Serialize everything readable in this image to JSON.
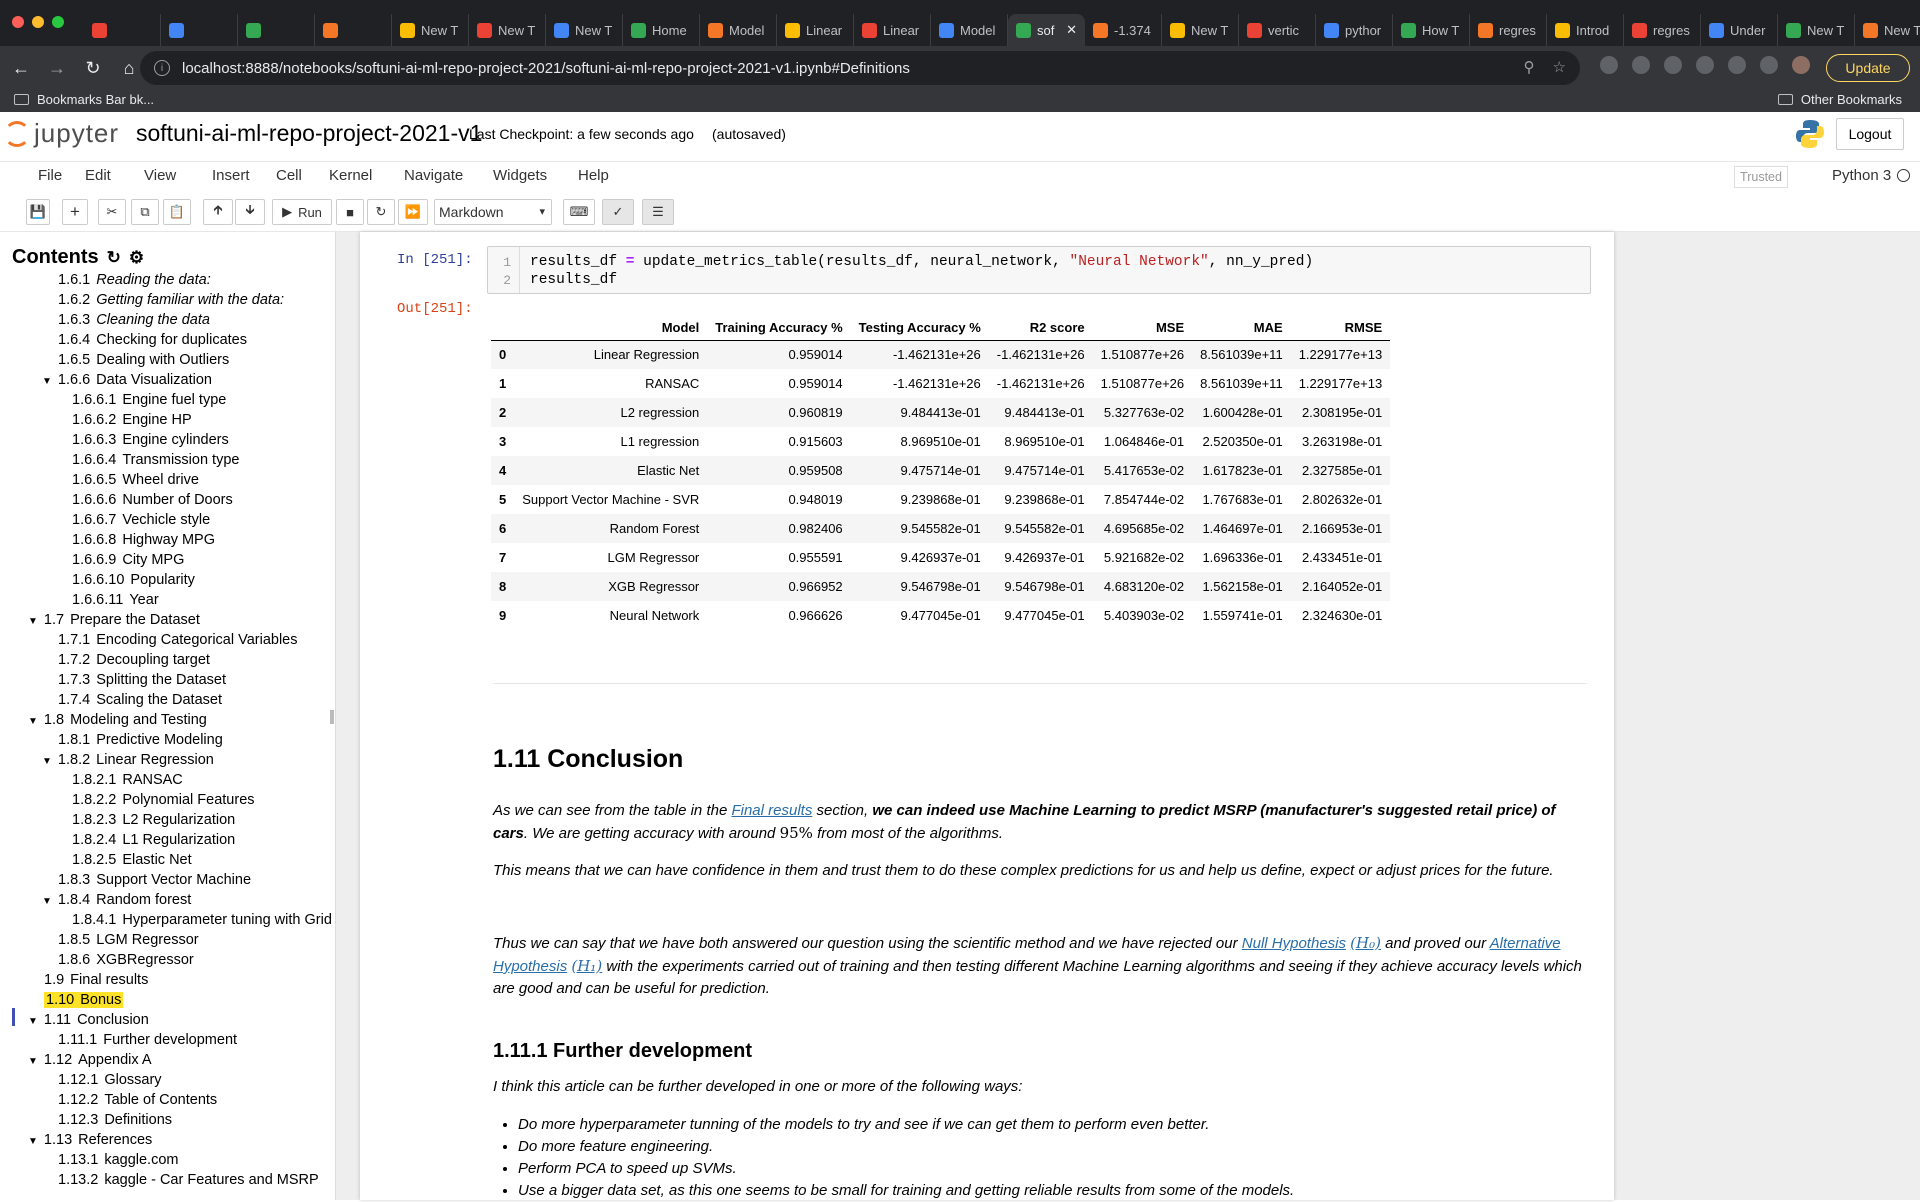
{
  "browser": {
    "tabs": [
      "",
      "",
      "",
      "",
      "New T",
      "New T",
      "New T",
      "Home",
      "Model",
      "Linear",
      "Linear",
      "Model",
      "sof",
      "-1.374",
      "New T",
      "vertic",
      "pythor",
      "How T",
      "regres",
      "Introd",
      "regres",
      "Under",
      "New T",
      "New T"
    ],
    "active_tab_index": 12,
    "url": "localhost:8888/notebooks/softuni-ai-ml-repo-project-2021/softuni-ai-ml-repo-project-2021-v1.ipynb#Definitions",
    "update_label": "Update",
    "bookmarks_left": "Bookmarks Bar bk...",
    "bookmarks_right": "Other Bookmarks"
  },
  "jupyter": {
    "logo_text": "jupyter",
    "notebook_name": "softuni-ai-ml-repo-project-2021-v1",
    "checkpoint": "Last Checkpoint: a few seconds ago",
    "autosaved": "(autosaved)",
    "logout": "Logout",
    "menus": [
      "File",
      "Edit",
      "View",
      "Insert",
      "Cell",
      "Kernel",
      "Navigate",
      "Widgets",
      "Help"
    ],
    "trusted": "Trusted",
    "kernel": "Python 3",
    "run_label": "Run",
    "cell_type": "Markdown"
  },
  "toc": {
    "title": "Contents",
    "items": [
      {
        "num": "1.6.1",
        "label": "Reading the data:",
        "italic": true
      },
      {
        "num": "1.6.2",
        "label": "Getting familiar with the data:",
        "italic": true
      },
      {
        "num": "1.6.3",
        "label": "Cleaning the data",
        "italic": true
      },
      {
        "num": "1.6.4",
        "label": "Checking for duplicates"
      },
      {
        "num": "1.6.5",
        "label": "Dealing with Outliers"
      },
      {
        "num": "1.6.6",
        "label": "Data Visualization"
      },
      {
        "num": "1.6.6.1",
        "label": "Engine fuel type"
      },
      {
        "num": "1.6.6.2",
        "label": "Engine HP"
      },
      {
        "num": "1.6.6.3",
        "label": "Engine cylinders"
      },
      {
        "num": "1.6.6.4",
        "label": "Transmission type"
      },
      {
        "num": "1.6.6.5",
        "label": "Wheel drive"
      },
      {
        "num": "1.6.6.6",
        "label": "Number of Doors"
      },
      {
        "num": "1.6.6.7",
        "label": "Vechicle style"
      },
      {
        "num": "1.6.6.8",
        "label": "Highway MPG"
      },
      {
        "num": "1.6.6.9",
        "label": "City MPG"
      },
      {
        "num": "1.6.6.10",
        "label": "Popularity"
      },
      {
        "num": "1.6.6.11",
        "label": "Year"
      },
      {
        "num": "1.7",
        "label": "Prepare the Dataset"
      },
      {
        "num": "1.7.1",
        "label": "Encoding Categorical Variables"
      },
      {
        "num": "1.7.2",
        "label": "Decoupling target"
      },
      {
        "num": "1.7.3",
        "label": "Splitting the Dataset"
      },
      {
        "num": "1.7.4",
        "label": "Scaling the Dataset"
      },
      {
        "num": "1.8",
        "label": "Modeling and Testing"
      },
      {
        "num": "1.8.1",
        "label": "Predictive Modeling"
      },
      {
        "num": "1.8.2",
        "label": "Linear Regression"
      },
      {
        "num": "1.8.2.1",
        "label": "RANSAC"
      },
      {
        "num": "1.8.2.2",
        "label": "Polynomial Features"
      },
      {
        "num": "1.8.2.3",
        "label": "L2 Regularization"
      },
      {
        "num": "1.8.2.4",
        "label": "L1 Regularization"
      },
      {
        "num": "1.8.2.5",
        "label": "Elastic Net"
      },
      {
        "num": "1.8.3",
        "label": "Support Vector Machine"
      },
      {
        "num": "1.8.4",
        "label": "Random forest"
      },
      {
        "num": "1.8.4.1",
        "label": "Hyperparameter tuning with Grid"
      },
      {
        "num": "1.8.5",
        "label": "LGM Regressor"
      },
      {
        "num": "1.8.6",
        "label": "XGBRegressor"
      },
      {
        "num": "1.9",
        "label": "Final results"
      },
      {
        "num": "1.10",
        "label": "Bonus"
      },
      {
        "num": "1.11",
        "label": "Conclusion"
      },
      {
        "num": "1.11.1",
        "label": "Further development"
      },
      {
        "num": "1.12",
        "label": "Appendix A"
      },
      {
        "num": "1.12.1",
        "label": "Glossary"
      },
      {
        "num": "1.12.2",
        "label": "Table of Contents"
      },
      {
        "num": "1.12.3",
        "label": "Definitions"
      },
      {
        "num": "1.13",
        "label": "References"
      },
      {
        "num": "1.13.1",
        "label": "kaggle.com"
      },
      {
        "num": "1.13.2",
        "label": "kaggle - Car Features and MSRP"
      }
    ]
  },
  "cell": {
    "in_prompt": "In [251]:",
    "out_prompt": "Out[251]:",
    "code_line1_a": "results_df ",
    "code_line1_op": "=",
    "code_line1_b": " update_metrics_table(results_df, neural_network, ",
    "code_line1_str": "\"Neural Network\"",
    "code_line1_c": ", nn_y_pred)",
    "code_line2": "results_df"
  },
  "table": {
    "columns": [
      "",
      "Model",
      "Training Accuracy %",
      "Testing Accuracy %",
      "R2 score",
      "MSE",
      "MAE",
      "RMSE"
    ],
    "rows": [
      [
        "0",
        "Linear Regression",
        "0.959014",
        "-1.462131e+26",
        "-1.462131e+26",
        "1.510877e+26",
        "8.561039e+11",
        "1.229177e+13"
      ],
      [
        "1",
        "RANSAC",
        "0.959014",
        "-1.462131e+26",
        "-1.462131e+26",
        "1.510877e+26",
        "8.561039e+11",
        "1.229177e+13"
      ],
      [
        "2",
        "L2 regression",
        "0.960819",
        "9.484413e-01",
        "9.484413e-01",
        "5.327763e-02",
        "1.600428e-01",
        "2.308195e-01"
      ],
      [
        "3",
        "L1 regression",
        "0.915603",
        "8.969510e-01",
        "8.969510e-01",
        "1.064846e-01",
        "2.520350e-01",
        "3.263198e-01"
      ],
      [
        "4",
        "Elastic Net",
        "0.959508",
        "9.475714e-01",
        "9.475714e-01",
        "5.417653e-02",
        "1.617823e-01",
        "2.327585e-01"
      ],
      [
        "5",
        "Support Vector Machine - SVR",
        "0.948019",
        "9.239868e-01",
        "9.239868e-01",
        "7.854744e-02",
        "1.767683e-01",
        "2.802632e-01"
      ],
      [
        "6",
        "Random Forest",
        "0.982406",
        "9.545582e-01",
        "9.545582e-01",
        "4.695685e-02",
        "1.464697e-01",
        "2.166953e-01"
      ],
      [
        "7",
        "LGM Regressor",
        "0.955591",
        "9.426937e-01",
        "9.426937e-01",
        "5.921682e-02",
        "1.696336e-01",
        "2.433451e-01"
      ],
      [
        "8",
        "XGB Regressor",
        "0.966952",
        "9.546798e-01",
        "9.546798e-01",
        "4.683120e-02",
        "1.562158e-01",
        "2.164052e-01"
      ],
      [
        "9",
        "Neural Network",
        "0.966626",
        "9.477045e-01",
        "9.477045e-01",
        "5.403903e-02",
        "1.559741e-01",
        "2.324630e-01"
      ]
    ]
  },
  "markdown": {
    "heading": "1.11  Conclusion",
    "p1_a": "As we can see from the table in the ",
    "p1_link": "Final results",
    "p1_b": " section, ",
    "p1_bold": "we can indeed use Machine Learning to predict MSRP (manufacturer's suggested retail price) of cars",
    "p1_c": ". We are getting accuracy with around ",
    "p1_pct": "95%",
    "p1_d": " from most of the algorithms.",
    "p2": "This means that we can have confidence in them and trust them to do these complex predictions for us and help us define, expect or adjust prices for the future.",
    "p3_a": "Thus we can say that we have both answered our question using the scientific method and we have rejected our ",
    "p3_link1": "Null Hypothesis",
    "p3_h0": "(H₀)",
    "p3_b": " and proved our ",
    "p3_link2": "Alternative Hypothesis",
    "p3_h1": "(H₁)",
    "p3_c": " with the experiments carried out of training and then testing different Machine Learning algorithms and seeing if they achieve accuracy levels which are good and can be useful for prediction.",
    "subheading": "1.11.1  Further development",
    "p4": "I think this article can be further developed in one or more of the following ways:",
    "bullets": [
      "Do more hyperparameter tunning of the models to try and see if we can get them to perform even better.",
      "Do more feature engineering.",
      "Perform PCA to speed up SVMs.",
      "Use a bigger data set, as this one seems to be small for training and getting reliable results from some of the models."
    ]
  }
}
